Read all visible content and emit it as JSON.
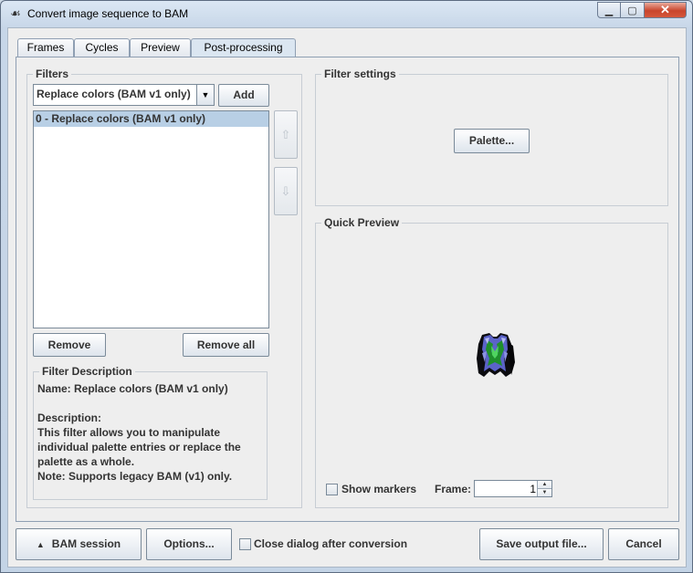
{
  "window": {
    "title": "Convert image sequence to BAM"
  },
  "tabs": [
    {
      "label": "Frames"
    },
    {
      "label": "Cycles"
    },
    {
      "label": "Preview"
    },
    {
      "label": "Post-processing"
    }
  ],
  "filters": {
    "group_label": "Filters",
    "combo_value": "Replace colors (BAM v1 only)",
    "add_label": "Add",
    "list_items": [
      "0 - Replace colors (BAM v1 only)"
    ],
    "move_up_icon": "up-arrow-icon",
    "move_down_icon": "down-arrow-icon",
    "remove_label": "Remove",
    "remove_all_label": "Remove all"
  },
  "filter_description": {
    "group_label": "Filter Description",
    "lines": [
      "Name: Replace colors (BAM v1 only)",
      "",
      "Description:",
      "This filter allows you to manipulate",
      "individual palette entries or replace the",
      "palette as a whole.",
      "Note: Supports legacy BAM (v1) only."
    ]
  },
  "filter_settings": {
    "group_label": "Filter settings",
    "palette_label": "Palette..."
  },
  "quick_preview": {
    "group_label": "Quick Preview",
    "show_markers_label": "Show markers",
    "frame_label": "Frame:",
    "frame_value": "1"
  },
  "footer": {
    "bam_session_label": "BAM session",
    "options_label": "Options...",
    "close_after_label": "Close dialog after conversion",
    "save_label": "Save output file...",
    "cancel_label": "Cancel"
  },
  "colors": {
    "accent": "#b8cfe5",
    "close_button": "#c9452c"
  }
}
